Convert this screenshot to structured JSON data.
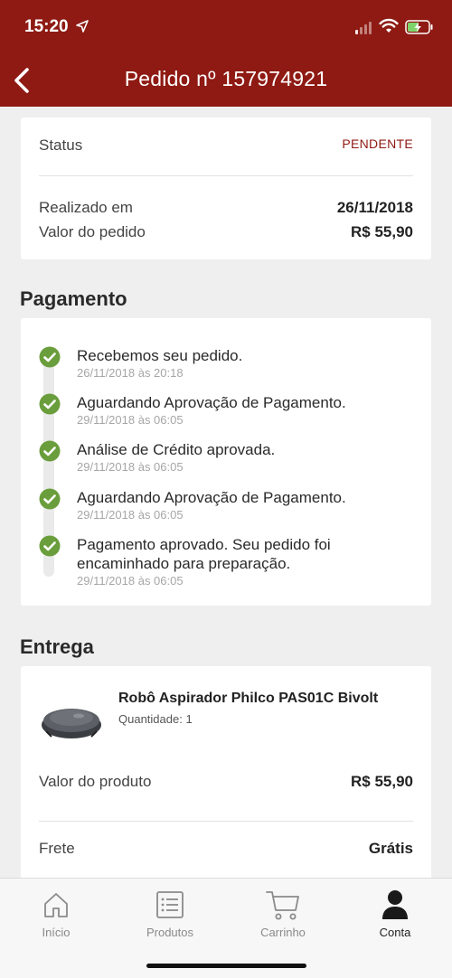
{
  "status_bar": {
    "time": "15:20"
  },
  "nav": {
    "title": "Pedido nº 157974921"
  },
  "summary": {
    "status_label": "Status",
    "status_value": "PENDENTE",
    "date_label": "Realizado em",
    "date_value": "26/11/2018",
    "total_label": "Valor do pedido",
    "total_value": "R$ 55,90"
  },
  "payment": {
    "title": "Pagamento",
    "steps": [
      {
        "text": "Recebemos seu pedido.",
        "date": "26/11/2018 às 20:18"
      },
      {
        "text": "Aguardando Aprovação de Pagamento.",
        "date": "29/11/2018 às 06:05"
      },
      {
        "text": "Análise de Crédito aprovada.",
        "date": "29/11/2018 às 06:05"
      },
      {
        "text": "Aguardando Aprovação de Pagamento.",
        "date": "29/11/2018 às 06:05"
      },
      {
        "text": "Pagamento aprovado. Seu pedido foi encaminhado para preparação.",
        "date": "29/11/2018 às 06:05"
      }
    ]
  },
  "delivery": {
    "title": "Entrega",
    "product_name": "Robô Aspirador Philco PAS01C Bivolt",
    "quantity": "Quantidade: 1",
    "product_value_label": "Valor do produto",
    "product_value": "R$ 55,90",
    "shipping_label": "Frete",
    "shipping_value": "Grátis"
  },
  "tabs": [
    {
      "label": "Início",
      "icon": "home-icon"
    },
    {
      "label": "Produtos",
      "icon": "list-icon"
    },
    {
      "label": "Carrinho",
      "icon": "cart-icon"
    },
    {
      "label": "Conta",
      "icon": "user-icon"
    }
  ],
  "colors": {
    "brand": "#8e1a13",
    "check": "#6a9e3c"
  }
}
